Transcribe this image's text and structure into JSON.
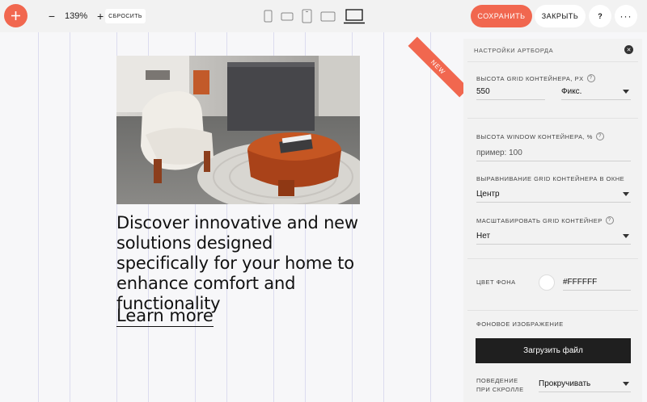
{
  "toolbar": {
    "zoom": "139%",
    "zoom_out": "−",
    "zoom_in": "+",
    "reset_label": "СБРОСИТЬ",
    "save_label": "СОХРАНИТЬ",
    "close_label": "ЗАКРЫТЬ",
    "help_label": "?",
    "more_label": "···",
    "accent_color": "#f1674f"
  },
  "canvas": {
    "hero_text": "Discover innovative and new solutions designed specifically for your home to enhance comfort and functionality",
    "link_text": "Learn more",
    "ribbon_text": "NEW"
  },
  "panel": {
    "title": "НАСТРОЙКИ АРТБОРДА",
    "grid_height_label": "ВЫСОТА GRID КОНТЕЙНЕРА, PX",
    "grid_height_value": "550",
    "grid_height_mode": "Фикс.",
    "window_height_label": "ВЫСОТА WINDOW КОНТЕЙНЕРА, %",
    "window_height_placeholder": "пример: 100",
    "align_label": "ВЫРАВНИВАНИЕ GRID КОНТЕЙНЕРА В ОКНЕ",
    "align_value": "Центр",
    "scale_label": "МАСШТАБИРОВАТЬ GRID КОНТЕЙНЕР",
    "scale_value": "Нет",
    "bg_color_label": "ЦВЕТ ФОНА",
    "bg_color_value": "#FFFFFF",
    "bg_image_label": "ФОНОВОЕ ИЗОБРАЖЕНИЕ",
    "upload_label": "Загрузить файл",
    "scroll_label_1": "ПОВЕДЕНИЕ",
    "scroll_label_2": "ПРИ СКРОЛЛЕ",
    "scroll_value": "Прокручивать"
  }
}
